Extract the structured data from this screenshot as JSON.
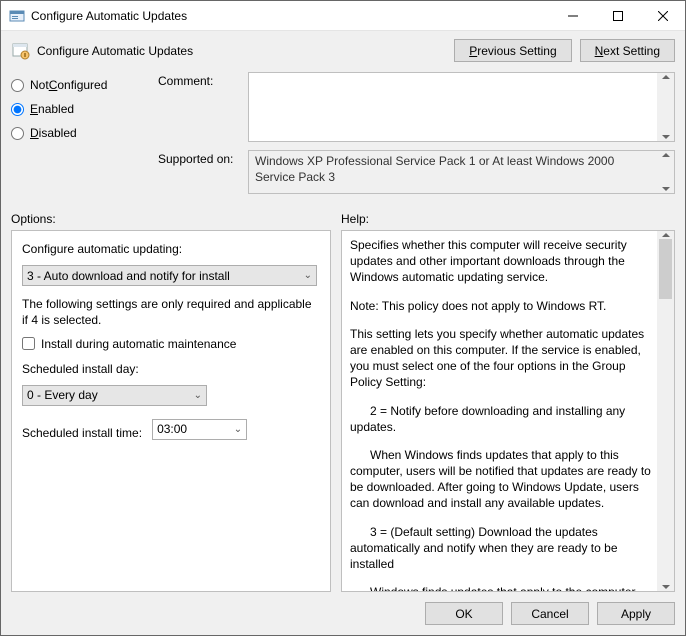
{
  "window": {
    "title": "Configure Automatic Updates"
  },
  "header": {
    "title": "Configure Automatic Updates",
    "prev_btn_prefix": "P",
    "prev_btn_rest": "revious Setting",
    "next_btn_prefix": "N",
    "next_btn_rest": "ext Setting"
  },
  "radios": {
    "not_configured_prefix": "Not ",
    "not_configured_u": "C",
    "not_configured_rest": "onfigured",
    "enabled_u": "E",
    "enabled_rest": "nabled",
    "disabled_u": "D",
    "disabled_rest": "isabled"
  },
  "labels": {
    "comment": "Comment:",
    "supported_on": "Supported on:",
    "options": "Options:",
    "help": "Help:"
  },
  "supported_text": "Windows XP Professional Service Pack 1 or At least Windows 2000 Service Pack 3",
  "options": {
    "configure_label": "Configure automatic updating:",
    "configure_value": "3 - Auto download and notify for install",
    "note": "The following settings are only required and applicable if 4 is selected.",
    "install_maint": "Install during automatic maintenance",
    "day_label": "Scheduled install day:",
    "day_value": "0 - Every day",
    "time_label": "Scheduled install time:",
    "time_value": "03:00"
  },
  "help": {
    "p1": "Specifies whether this computer will receive security updates and other important downloads through the Windows automatic updating service.",
    "p2": "Note: This policy does not apply to Windows RT.",
    "p3": "This setting lets you specify whether automatic updates are enabled on this computer. If the service is enabled, you must select one of the four options in the Group Policy Setting:",
    "p4": "2 = Notify before downloading and installing any updates.",
    "p5": "When Windows finds updates that apply to this computer, users will be notified that updates are ready to be downloaded. After going to Windows Update, users can download and install any available updates.",
    "p6": "3 = (Default setting) Download the updates automatically and notify when they are ready to be installed",
    "p7": "Windows finds updates that apply to the computer and"
  },
  "buttons": {
    "ok": "OK",
    "cancel": "Cancel",
    "apply": "Apply"
  }
}
